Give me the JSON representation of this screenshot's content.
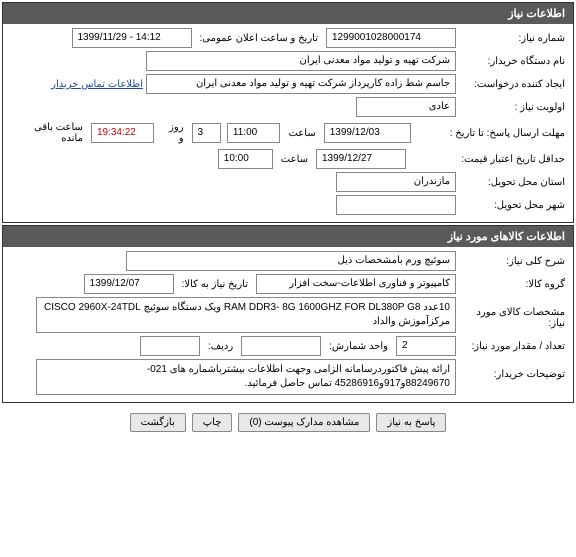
{
  "section1": {
    "title": "اطلاعات نیاز",
    "fields": {
      "need_number_label": "شماره نیاز:",
      "need_number": "1299001028000174",
      "announce_label": "تاریخ و ساعت اعلان عمومی:",
      "announce_value": "1399/11/29 - 14:12",
      "buyer_org_label": "نام دستگاه خریدار:",
      "buyer_org": "شرکت تهیه و تولید مواد معدنی ایران",
      "creator_label": "ایجاد کننده درخواست:",
      "creator": "جاسم شط زاده کارپرداز شرکت تهیه و تولید مواد معدنی ایران",
      "contact_link": "اطلاعات تماس خریدار",
      "priority_label": "اولویت نیاز :",
      "priority": "عادی",
      "deadline_label": "مهلت ارسال پاسخ:",
      "to_date_label": "تا تاریخ :",
      "deadline_date": "1399/12/03",
      "time_label": "ساعت",
      "deadline_time": "11:00",
      "day_label": "روز و",
      "days_remain": "3",
      "countdown": "19:34:22",
      "remain_label": "ساعت باقی مانده",
      "min_valid_label": "حداقل تاریخ اعتبار قیمت:",
      "min_valid_date": "1399/12/27",
      "min_valid_time": "10:00",
      "province_label": "استان محل تحویل:",
      "province": "مازندران",
      "city_label": "شهر محل تحویل:",
      "city": ""
    }
  },
  "section2": {
    "title": "اطلاعات کالاهای مورد نیاز",
    "fields": {
      "overall_desc_label": "شرح کلی نیاز:",
      "overall_desc": "سوئیچ ورم بامشخصات ذیل",
      "goods_group_label": "گروه کالا:",
      "goods_group": "کامپیوتر و فناوری اطلاعات-سخت افزار",
      "need_by_label": "تاریخ نیاز به کالا:",
      "need_by": "1399/12/07",
      "specs_label": "مشخصات کالای مورد نیاز:",
      "specs": "10عدد RAM DDR3- 8G 1600GHZ FOR DL380P G8 ویک دستگاه سوئیچ CISCO 2960X-24TDL مرکزآموزش والداد",
      "qty_label": "تعداد / مقدار مورد نیاز:",
      "qty": "2",
      "unit_label": "واحد شمارش:",
      "unit": "",
      "row_label": "ردیف:",
      "row": "",
      "buyer_notes_label": "توضیحات خریدار:",
      "buyer_notes": "ارائه پیش فاکتوردرسامانه الزامی وجهت اطلاعات بیشترباشماره های 021-88249670و917و45286916 تماس حاصل فرمائید."
    }
  },
  "buttons": {
    "reply": "پاسخ به نیاز",
    "view_docs": "مشاهده مدارک پیوست",
    "doc_count": "0",
    "print": "چاپ",
    "back": "بازگشت"
  }
}
